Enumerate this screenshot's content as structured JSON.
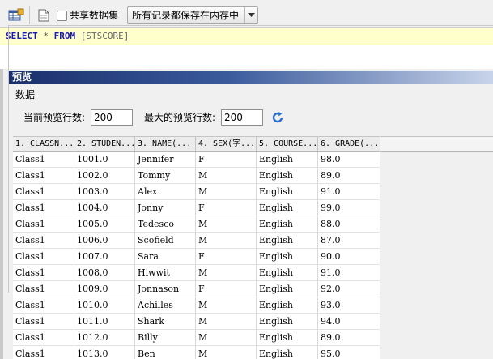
{
  "toolbar": {
    "checkbox_label": "共享数据集",
    "shared_checked": false,
    "mode_select": "所有记录都保存在内存中",
    "icons": [
      "table-icon",
      "document-icon",
      "dropdown-arrow-icon"
    ]
  },
  "sql": {
    "keyword_select": "SELECT",
    "star": " * ",
    "keyword_from": "FROM",
    "table": " [STSCORE]"
  },
  "panel": {
    "title": "预览",
    "group_label": "数据",
    "current_rows_label": "当前预览行数:",
    "current_rows_value": "200",
    "max_rows_label": "最大的预览行数:",
    "max_rows_value": "200",
    "refresh_icon": "refresh-icon"
  },
  "grid": {
    "columns": [
      "1. CLASSN...",
      "2. STUDEN...",
      "3. NAME(...",
      "4. SEX(字...",
      "5. COURSE...",
      "6. GRADE(..."
    ],
    "rows": [
      [
        "Class1",
        "1001.0",
        "Jennifer",
        "F",
        "English",
        "98.0"
      ],
      [
        "Class1",
        "1002.0",
        "Tommy",
        "M",
        "English",
        "89.0"
      ],
      [
        "Class1",
        "1003.0",
        "Alex",
        "M",
        "English",
        "91.0"
      ],
      [
        "Class1",
        "1004.0",
        "Jonny",
        "F",
        "English",
        "99.0"
      ],
      [
        "Class1",
        "1005.0",
        "Tedesco",
        "M",
        "English",
        "88.0"
      ],
      [
        "Class1",
        "1006.0",
        "Scofield",
        "M",
        "English",
        "87.0"
      ],
      [
        "Class1",
        "1007.0",
        "Sara",
        "F",
        "English",
        "90.0"
      ],
      [
        "Class1",
        "1008.0",
        "Hiwwit",
        "M",
        "English",
        "91.0"
      ],
      [
        "Class1",
        "1009.0",
        "Jonnason",
        "F",
        "English",
        "92.0"
      ],
      [
        "Class1",
        "1010.0",
        "Achilles",
        "M",
        "English",
        "93.0"
      ],
      [
        "Class1",
        "1011.0",
        "Shark",
        "M",
        "English",
        "94.0"
      ],
      [
        "Class1",
        "1012.0",
        "Billy",
        "M",
        "English",
        "89.0"
      ],
      [
        "Class1",
        "1013.0",
        "Ben",
        "M",
        "English",
        "95.0"
      ]
    ]
  }
}
